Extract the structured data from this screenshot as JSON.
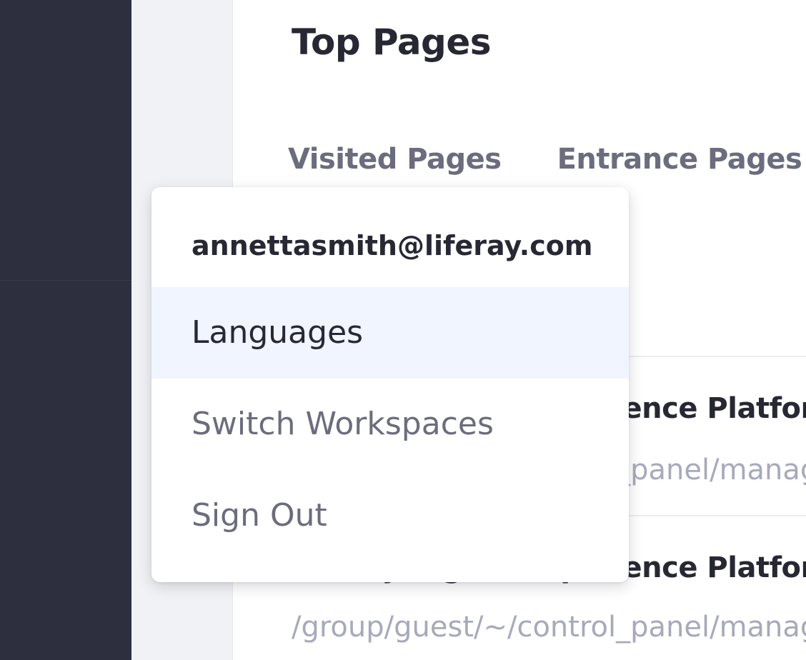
{
  "page": {
    "title": "Top Pages",
    "tabs": [
      {
        "label": "Visited Pages"
      },
      {
        "label": "Entrance Pages"
      }
    ],
    "rows": [
      {
        "title": "Liferay Digital Experience Platform",
        "url": "/group/guest/~/control_panel/manage"
      },
      {
        "title": "Liferay Digital Experience Platform",
        "url": "/group/guest/~/control_panel/manage"
      }
    ]
  },
  "user_menu": {
    "email": "annettasmith@liferay.com",
    "items": [
      {
        "label": "Languages",
        "state": "hovered"
      },
      {
        "label": "Switch Workspaces"
      },
      {
        "label": "Sign Out"
      }
    ]
  },
  "colors": {
    "sidebar": "#2d2f3e",
    "menu_highlight": "#f0f5ff",
    "text_primary": "#272833",
    "text_secondary": "#6b6c7e",
    "text_muted": "#a7a9bc"
  }
}
